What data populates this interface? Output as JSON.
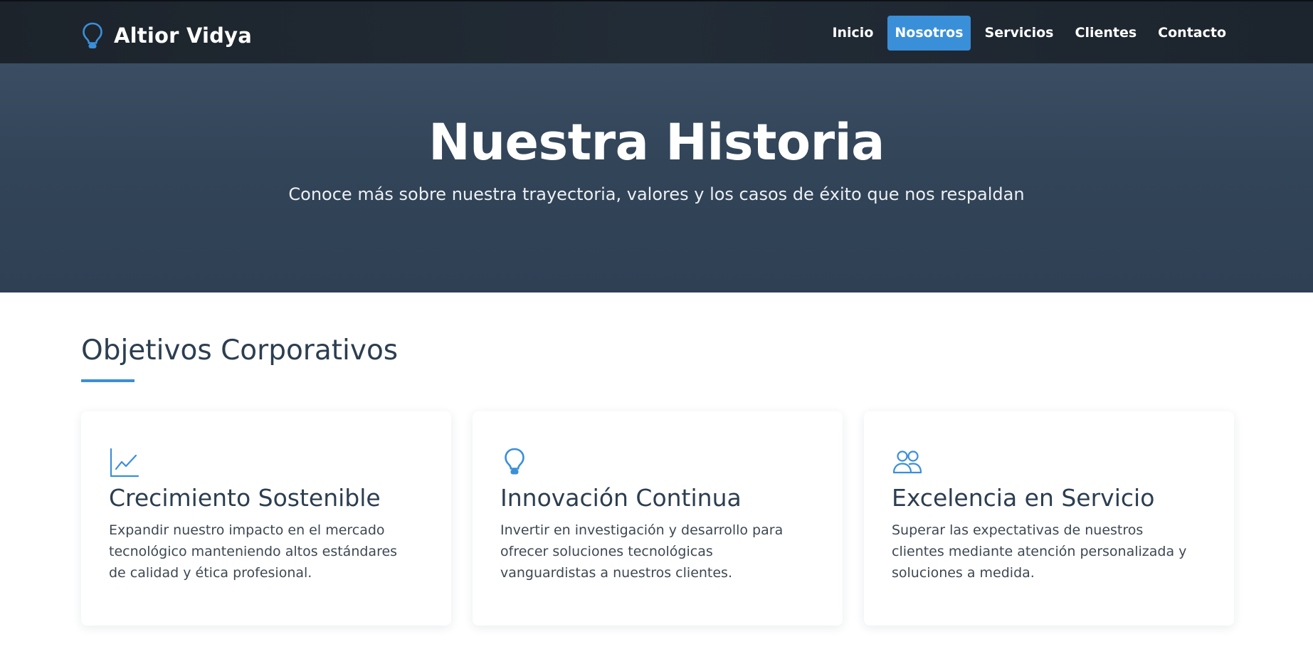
{
  "brand": {
    "name": "Altior Vidya",
    "icon": "lightbulb-icon"
  },
  "nav": {
    "items": [
      {
        "label": "Inicio",
        "active": false
      },
      {
        "label": "Nosotros",
        "active": true
      },
      {
        "label": "Servicios",
        "active": false
      },
      {
        "label": "Clientes",
        "active": false
      },
      {
        "label": "Contacto",
        "active": false
      }
    ]
  },
  "hero": {
    "title": "Nuestra Historia",
    "subtitle": "Conoce más sobre nuestra trayectoria, valores y los casos de éxito que nos respaldan"
  },
  "objectives": {
    "title": "Objetivos Corporativos",
    "cards": [
      {
        "icon": "chart-line-icon",
        "title": "Crecimiento Sostenible",
        "text": "Expandir nuestro impacto en el mercado tecnológico manteniendo altos estándares de calidad y ética profesional."
      },
      {
        "icon": "lightbulb-icon",
        "title": "Innovación Continua",
        "text": "Invertir en investigación y desarrollo para ofrecer soluciones tecnológicas vanguardistas a nuestros clientes."
      },
      {
        "icon": "people-icon",
        "title": "Excelencia en Servicio",
        "text": "Superar las expectativas de nuestros clientes mediante atención personalizada y soluciones a medida."
      }
    ]
  },
  "colors": {
    "accent": "#3a8fd9",
    "navbar": "#1f2730",
    "hero": "#334559",
    "heading": "#2c3e50"
  }
}
